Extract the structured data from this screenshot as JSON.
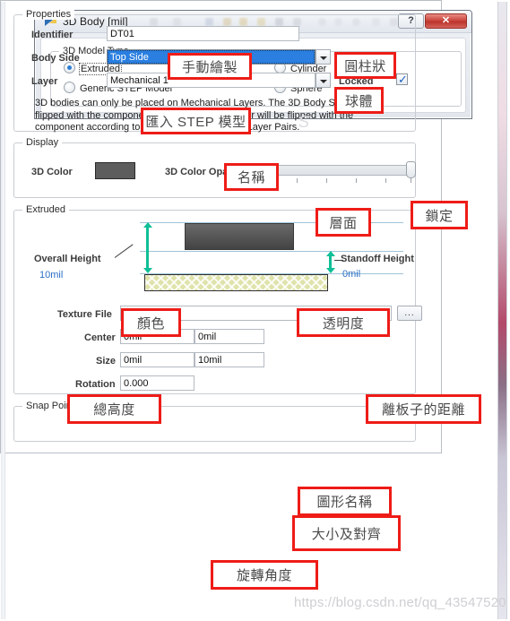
{
  "top_dialog": {
    "title": "3D Body [mil]",
    "icon": "3d-body-icon",
    "help_label": "?",
    "close_label": "✕",
    "group_title": "3D Model Type",
    "options": [
      {
        "label": "Extruded",
        "selected": true
      },
      {
        "label": "Generic STEP Model",
        "selected": false
      },
      {
        "label": "Cylinder",
        "selected": false
      },
      {
        "label": "Sphere",
        "selected": false
      }
    ]
  },
  "properties": {
    "group_title": "Properties",
    "identifier_label": "Identifier",
    "identifier_value": "DT01",
    "body_side_label": "Body Side",
    "body_side_value": "Top Side",
    "layer_label": "Layer",
    "layer_value": "Mechanical 1",
    "locked_label": "Locked",
    "locked_checked": true,
    "note": "3D bodies can only be placed on Mechanical Layers. The 3D Body Side will be flipped with the component. The Mechanical Layer will be flipped with the component according to the defined Mechanical Layer Pairs."
  },
  "display": {
    "group_title": "Display",
    "color_label": "3D Color",
    "color_value": "#5d5d5d",
    "opacity_label": "3D Color Opacity",
    "opacity_percent": 100
  },
  "extruded": {
    "group_title": "Extruded",
    "overall_height_label": "Overall Height",
    "overall_height_value": "10mil",
    "standoff_height_label": "Standoff Height",
    "standoff_height_value": "0mil",
    "texture_file_label": "Texture File",
    "texture_file_value": "",
    "browse_label": "...",
    "center_label": "Center",
    "center_x": "0mil",
    "center_y": "0mil",
    "size_label": "Size",
    "size_x": "0mil",
    "size_y": "10mil",
    "rotation_label": "Rotation",
    "rotation_value": "0.000"
  },
  "snap_points": {
    "group_title": "Snap Points"
  },
  "annotations": {
    "manual_draw": "手動繪製",
    "import_step": "匯入 STEP 模型",
    "cylinder": "圓柱狀",
    "sphere": "球體",
    "name": "名稱",
    "layer_face": "層面",
    "lock": "鎖定",
    "color": "顏色",
    "opacity": "透明度",
    "total_height": "總高度",
    "standoff_distance": "離板子的距離",
    "graphic_name": "圖形名稱",
    "size_and_align": "大小及對齊",
    "rotation_angle": "旋轉角度"
  },
  "watermark": {
    "text": "https://blog.csdn.net/qq_43547520"
  },
  "colors": {
    "annotation_border": "#ee1c17",
    "selection_blue": "#2a7fe0",
    "dim_arrow_green": "#0fbf97",
    "board_green": "#dfe3ab",
    "body_gray": "#5d5d5d"
  }
}
